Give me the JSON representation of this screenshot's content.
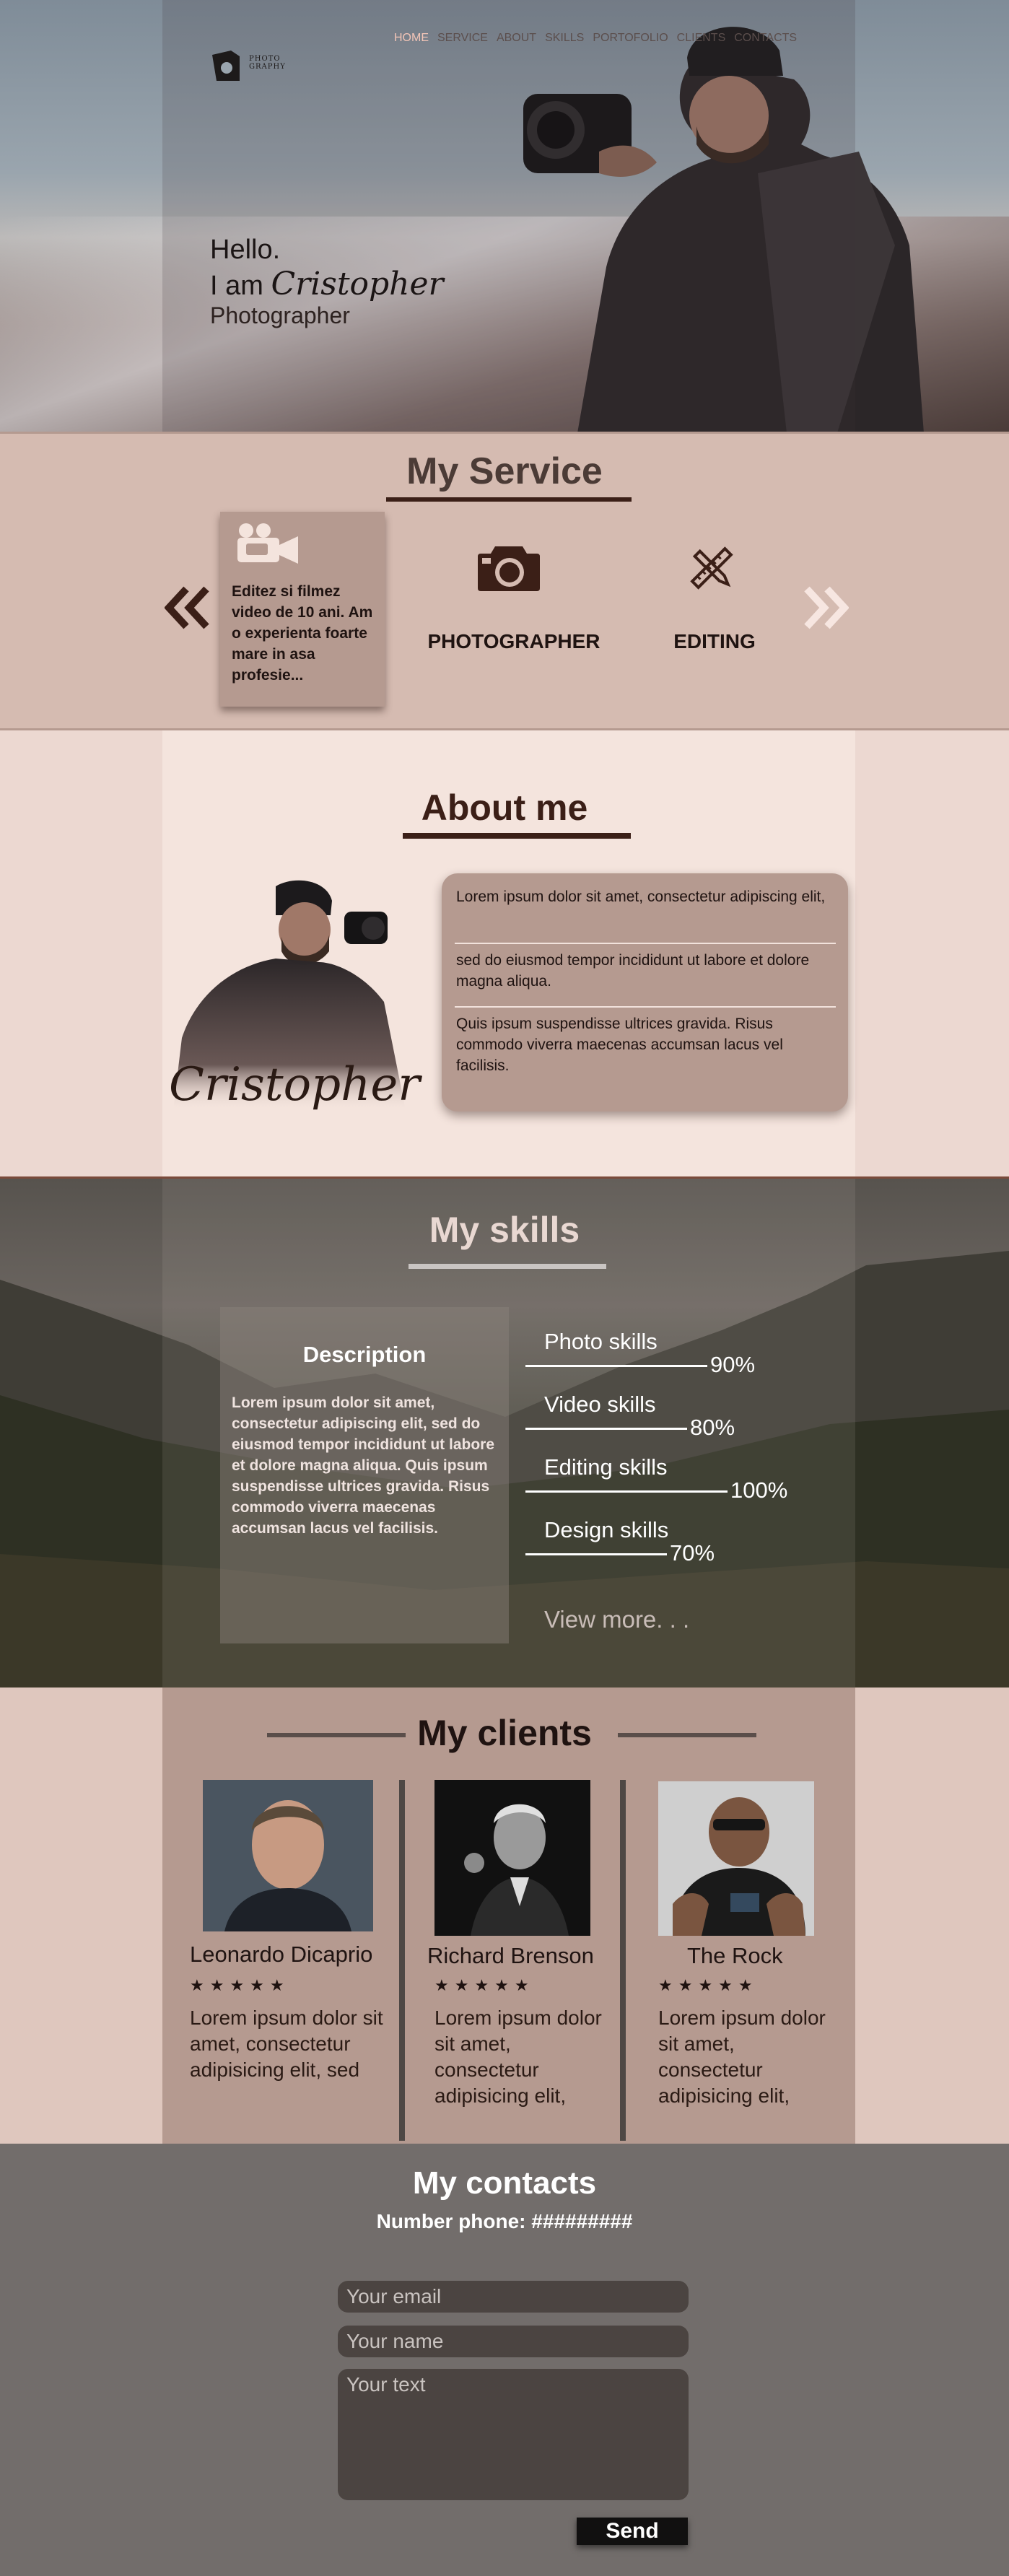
{
  "header": {
    "logo_text": "PHOTO GRAPHY",
    "nav": [
      "HOME",
      "SERVICE",
      "ABOUT",
      "SKILLS",
      "PORTOFOLIO",
      "CLIENTS",
      "CONTACTS"
    ],
    "active_nav": "HOME",
    "hello": "Hello.",
    "i_am": "I am",
    "name": "Cristopher",
    "job": "Photographer"
  },
  "service": {
    "title": "My Service",
    "prev_icon": "double-chevron-left-icon",
    "next_icon": "double-chevron-right-icon",
    "video_text": "Editez si filmez video de 10 ani. Am o experienta foarte mare in asa profesie...",
    "photographer_label": "PHOTOGRAPHER",
    "editing_label": "EDITING"
  },
  "about": {
    "title": "About me",
    "name": "Cristopher",
    "p1": "Lorem ipsum dolor sit amet, consectetur adipiscing elit,",
    "p2": "sed do eiusmod tempor incididunt ut labore et dolore magna aliqua.",
    "p3": "Quis ipsum suspendisse ultrices gravida. Risus commodo viverra maecenas accumsan lacus vel facilisis."
  },
  "skills": {
    "title": "My skills",
    "desc_title": "Description",
    "desc_text": "Lorem ipsum dolor sit amet, consectetur adipiscing elit, sed do eiusmod tempor incididunt ut labore et dolore magna aliqua. Quis ipsum suspendisse ultrices gravida. Risus commodo viverra maecenas accumsan lacus vel facilisis.",
    "items": [
      {
        "name": "Photo skills",
        "pct": "90%",
        "value": 90
      },
      {
        "name": "Video skills",
        "pct": "80%",
        "value": 80
      },
      {
        "name": "Editing skills",
        "pct": "100%",
        "value": 100
      },
      {
        "name": "Design skills",
        "pct": "70%",
        "value": 70
      }
    ],
    "view_more": "View more. . ."
  },
  "clients": {
    "title": "My clients",
    "stars": "★★★★★",
    "items": [
      {
        "name": "Leonardo Dicaprio",
        "text": "Lorem ipsum dolor sit amet, consectetur adipisicing elit, sed"
      },
      {
        "name": "Richard Brenson",
        "text": "Lorem ipsum dolor sit amet, consectetur adipisicing elit,"
      },
      {
        "name": "The Rock",
        "text": "Lorem ipsum dolor sit amet, consectetur adipisicing elit,"
      }
    ]
  },
  "contacts": {
    "title": "My contacts",
    "phone": "Number phone: #########",
    "email_placeholder": "Your email",
    "name_placeholder": "Your name",
    "text_placeholder": "Your text",
    "send": "Send"
  },
  "colors": {
    "dark_brown": "#3b1f17",
    "rose": "#b59a90",
    "light_rose": "#f4e4dd",
    "accent_nav": "#f3c5b7",
    "footer_gray": "#726d6b"
  }
}
